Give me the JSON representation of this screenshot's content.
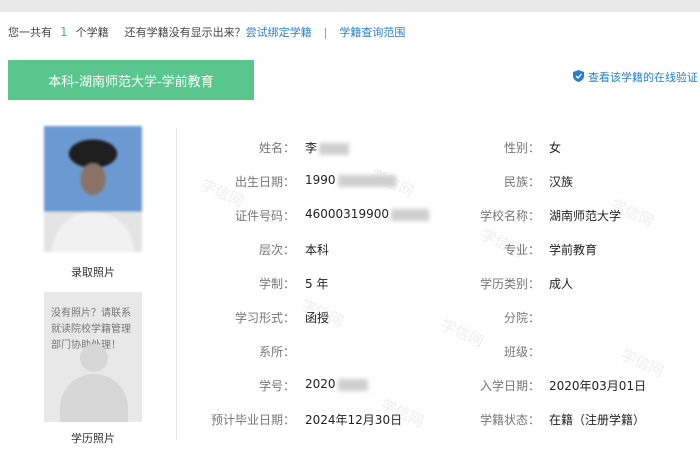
{
  "summary": {
    "prefix": "您一共有",
    "count": "1",
    "suffix": "个学籍",
    "question": "还有学籍没有显示出来？",
    "bind_link": "尝试绑定学籍",
    "separator": "|",
    "scope_link": "学籍查询范围"
  },
  "record": {
    "tab_title": "本科-湖南师范大学-学前教育",
    "verify_link": "查看该学籍的在线验证"
  },
  "photos": {
    "enrollment_caption": "录取照片",
    "degree_caption": "学历照片",
    "no_photo_message": "没有照片？请联系就读院校学籍管理部门协助处理！"
  },
  "fields_left": [
    {
      "label": "姓名：",
      "value": "李"
    },
    {
      "label": "出生日期：",
      "value": "1990"
    },
    {
      "label": "证件号码：",
      "value": "46000319900"
    },
    {
      "label": "层次：",
      "value": "本科"
    },
    {
      "label": "学制：",
      "value": "5 年"
    },
    {
      "label": "学习形式：",
      "value": "函授"
    },
    {
      "label": "系所：",
      "value": ""
    },
    {
      "label": "学号：",
      "value": "2020"
    },
    {
      "label": "预计毕业日期：",
      "value": "2024年12月30日"
    }
  ],
  "fields_right": [
    {
      "label": "性别：",
      "value": "女"
    },
    {
      "label": "民族：",
      "value": "汉族"
    },
    {
      "label": "学校名称：",
      "value": "湖南师范大学"
    },
    {
      "label": "专业：",
      "value": "学前教育"
    },
    {
      "label": "学历类别：",
      "value": "成人"
    },
    {
      "label": "分院：",
      "value": ""
    },
    {
      "label": "班级：",
      "value": ""
    },
    {
      "label": "入学日期：",
      "value": "2020年03月01日"
    },
    {
      "label": "学籍状态：",
      "value": "在籍（注册学籍）"
    }
  ],
  "watermark_text": "学信网",
  "colors": {
    "accent_green": "#59c68d",
    "link_blue": "#2b7fc7"
  }
}
